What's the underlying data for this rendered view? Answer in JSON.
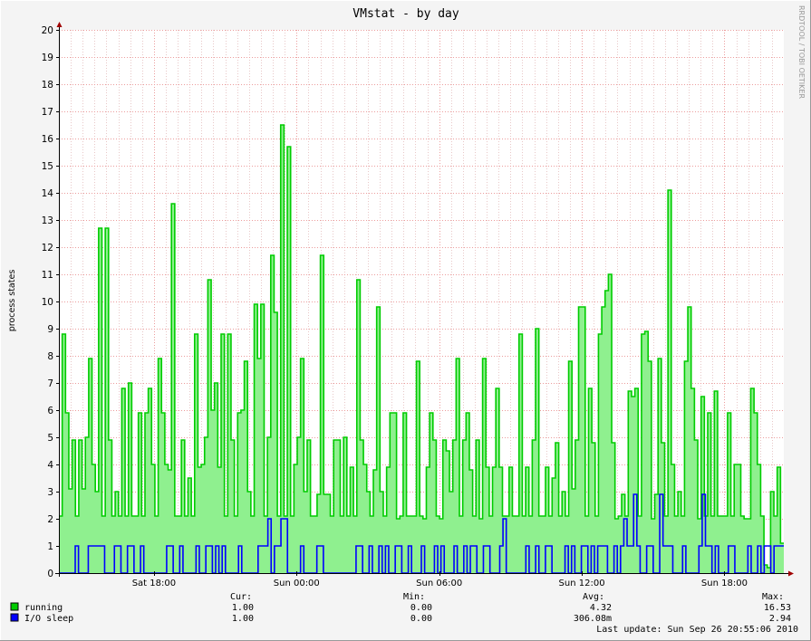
{
  "chart_data": {
    "type": "line",
    "title": "VMstat - by day",
    "ylabel": "process states",
    "watermark": "RRDTOOL / TOBI OETIKER",
    "ylim": [
      0,
      20
    ],
    "y_ticks": [
      "0",
      "1",
      "2",
      "3",
      "4",
      "5",
      "6",
      "7",
      "8",
      "9",
      "10",
      "11",
      "12",
      "13",
      "14",
      "15",
      "16",
      "17",
      "18",
      "19",
      "20"
    ],
    "x_ticks": [
      {
        "label": "Sat 18:00",
        "hour": 4
      },
      {
        "label": "Sun 00:00",
        "hour": 10
      },
      {
        "label": "Sun 06:00",
        "hour": 16
      },
      {
        "label": "Sun 12:00",
        "hour": 22
      },
      {
        "label": "Sun 18:00",
        "hour": 28
      }
    ],
    "xlim_hours": [
      0,
      30.5
    ],
    "series": [
      {
        "name": "running",
        "color": "#00cc00",
        "fill": "#8ff08f",
        "values": [
          2.1,
          8.8,
          5.9,
          3.1,
          4.9,
          2.1,
          4.9,
          3.1,
          5.0,
          7.9,
          4.0,
          3.0,
          12.7,
          2.1,
          12.7,
          4.9,
          2.1,
          3.0,
          2.1,
          6.8,
          2.1,
          7.0,
          2.1,
          2.1,
          5.9,
          2.1,
          5.9,
          6.8,
          4.0,
          2.1,
          7.9,
          5.9,
          4.0,
          3.8,
          13.6,
          2.1,
          2.1,
          4.9,
          2.1,
          3.5,
          2.1,
          8.8,
          3.9,
          4.0,
          5.0,
          10.8,
          6.0,
          7.0,
          3.9,
          8.8,
          2.1,
          8.8,
          4.9,
          2.1,
          5.9,
          6.0,
          7.8,
          3.0,
          2.1,
          9.9,
          7.9,
          9.9,
          2.1,
          5.0,
          11.7,
          9.6,
          2.1,
          16.5,
          2.1,
          15.7,
          2.1,
          4.0,
          5.0,
          7.9,
          3.0,
          4.9,
          2.1,
          2.1,
          2.9,
          11.7,
          2.9,
          2.9,
          2.1,
          4.9,
          4.9,
          2.1,
          5.0,
          2.1,
          3.9,
          2.1,
          10.8,
          4.9,
          4.0,
          3.0,
          2.1,
          3.8,
          9.8,
          3.0,
          2.1,
          3.9,
          5.9,
          5.9,
          2.0,
          2.1,
          5.9,
          2.1,
          2.1,
          2.1,
          7.8,
          2.1,
          2.0,
          3.9,
          5.9,
          4.9,
          2.1,
          2.0,
          4.9,
          4.5,
          3.0,
          4.9,
          7.9,
          2.1,
          4.9,
          5.9,
          3.8,
          2.1,
          4.9,
          2.0,
          7.9,
          3.9,
          2.1,
          3.9,
          6.8,
          3.9,
          2.1,
          2.1,
          3.9,
          2.1,
          2.1,
          8.8,
          2.1,
          3.9,
          2.1,
          4.9,
          9.0,
          2.1,
          2.1,
          3.9,
          2.1,
          3.5,
          4.8,
          2.1,
          3.0,
          2.1,
          7.8,
          3.1,
          4.9,
          9.8,
          9.8,
          2.1,
          6.8,
          4.8,
          2.1,
          8.8,
          9.8,
          10.4,
          11.0,
          4.8,
          2.0,
          2.1,
          2.9,
          2.1,
          6.7,
          6.5,
          6.8,
          2.1,
          8.8,
          8.9,
          7.8,
          2.0,
          2.9,
          7.9,
          4.8,
          2.1,
          14.1,
          4.0,
          2.1,
          3.0,
          2.1,
          7.8,
          9.8,
          6.8,
          4.9,
          2.0,
          6.5,
          2.1,
          5.9,
          2.1,
          6.7,
          2.1,
          2.1,
          2.1,
          5.9,
          2.1,
          4.0,
          4.0,
          2.1,
          2.0,
          2.0,
          6.8,
          5.9,
          4.0,
          2.1,
          0.3,
          0.2,
          3.0,
          2.1,
          3.9,
          1.1
        ]
      },
      {
        "name": "I/O sleep",
        "color": "#0000ff",
        "fill": "#0000ff",
        "values": [
          0,
          0,
          0,
          0,
          0,
          1,
          0,
          0,
          0,
          1,
          1,
          1,
          1,
          1,
          0,
          0,
          0,
          1,
          1,
          0,
          0,
          1,
          1,
          0,
          0,
          1,
          0,
          0,
          0,
          0,
          0,
          0,
          0,
          1,
          1,
          0,
          0,
          1,
          0,
          0,
          0,
          0,
          1,
          0,
          0,
          1,
          1,
          0,
          1,
          0,
          1,
          0,
          0,
          0,
          0,
          1,
          0,
          0,
          0,
          0,
          0,
          1,
          1,
          1,
          2,
          0,
          1,
          1,
          2,
          2,
          0,
          0,
          0,
          0,
          1,
          0,
          0,
          0,
          0,
          1,
          1,
          0,
          0,
          0,
          0,
          0,
          0,
          0,
          0,
          0,
          0,
          1,
          1,
          0,
          0,
          1,
          0,
          0,
          1,
          0,
          1,
          0,
          0,
          1,
          1,
          0,
          0,
          1,
          0,
          0,
          0,
          1,
          0,
          0,
          0,
          1,
          0,
          1,
          0,
          0,
          0,
          1,
          0,
          0,
          1,
          0,
          1,
          1,
          0,
          0,
          1,
          1,
          0,
          0,
          0,
          1,
          2,
          0,
          0,
          0,
          0,
          0,
          0,
          1,
          0,
          0,
          1,
          0,
          0,
          1,
          1,
          0,
          0,
          0,
          0,
          1,
          0,
          1,
          0,
          0,
          1,
          1,
          0,
          1,
          0,
          1,
          1,
          1,
          0,
          0,
          1,
          0,
          1,
          2,
          1,
          1,
          2.9,
          1,
          0,
          0,
          1,
          1,
          0,
          0,
          2.9,
          1,
          1,
          1,
          0,
          0,
          0,
          1,
          0,
          0,
          0,
          0,
          1,
          2.9,
          1,
          1,
          0,
          1,
          0,
          0,
          0,
          1,
          1,
          0,
          0,
          0,
          0,
          1,
          0,
          0,
          1,
          0,
          1,
          1,
          0,
          1,
          1,
          1
        ]
      }
    ],
    "legend": {
      "headers": [
        "Cur:",
        "Min:",
        "Avg:",
        "Max:"
      ],
      "rows": [
        {
          "name": "running",
          "color": "#00cc00",
          "cur": "1.00",
          "min": "0.00",
          "avg": "4.32",
          "max": "16.53"
        },
        {
          "name": "I/O sleep",
          "color": "#0000ff",
          "cur": "1.00",
          "min": "0.00",
          "avg": "306.08m",
          "max": "2.94"
        }
      ]
    },
    "last_update": "Last update: Sun Sep 26 20:55:06 2010"
  }
}
